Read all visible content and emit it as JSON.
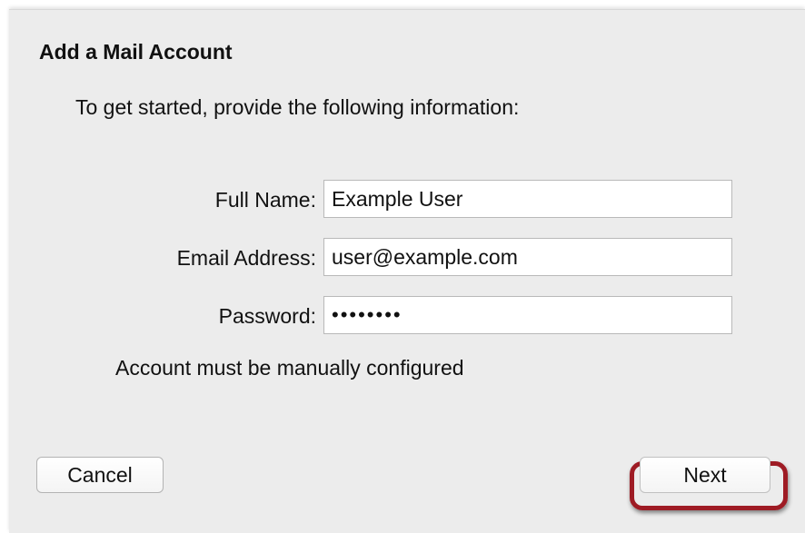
{
  "dialog": {
    "title": "Add a Mail Account",
    "intro": "To get started, provide the following information:"
  },
  "form": {
    "full_name": {
      "label": "Full Name:",
      "value": "Example User"
    },
    "email": {
      "label": "Email Address:",
      "value": "user@example.com"
    },
    "password": {
      "label": "Password:",
      "value": "••••••••"
    }
  },
  "status": {
    "note": "Account must be manually configured"
  },
  "buttons": {
    "cancel_label": "Cancel",
    "next_label": "Next"
  },
  "colors": {
    "dialog_background": "#ececec",
    "highlight": "#9e1b24"
  }
}
